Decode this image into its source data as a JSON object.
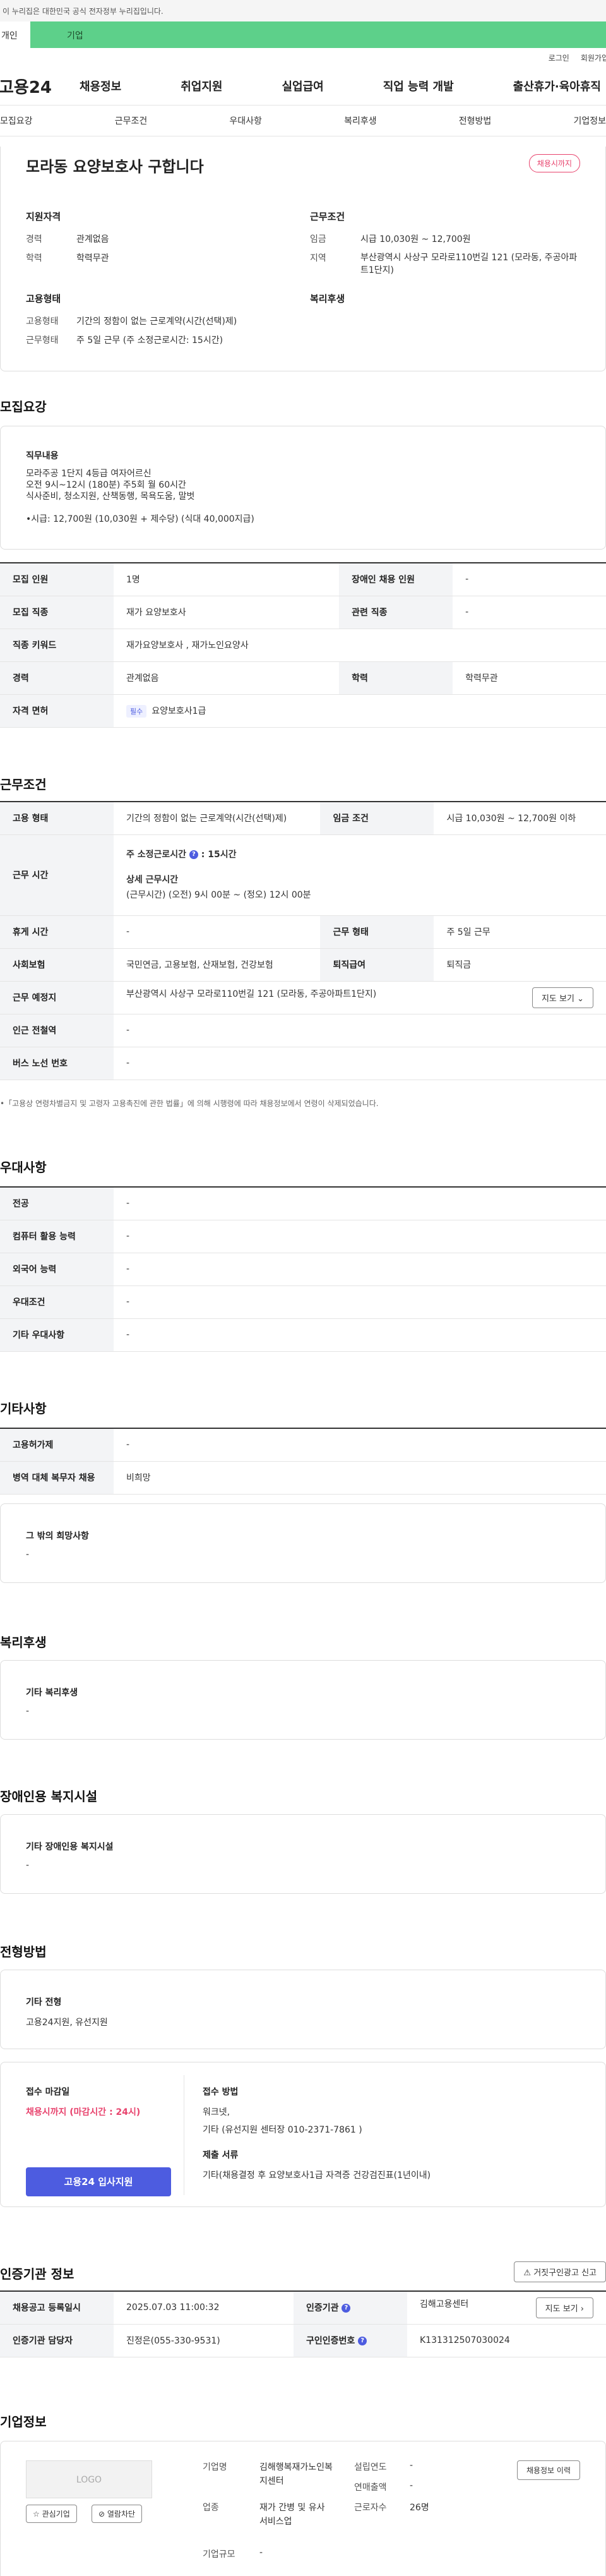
{
  "gov_banner": "이 누리집은 대한민국 공식 전자정부 누리집입니다.",
  "tabs": {
    "personal": "개인",
    "company": "기업"
  },
  "util": {
    "login": "로그인",
    "join": "회원가입"
  },
  "logo": "고용24",
  "gnb": [
    "채용정보",
    "취업지원",
    "실업급여",
    "직업 능력 개발",
    "출산휴가·육아휴직"
  ],
  "subnav": [
    "모집요강",
    "근무조건",
    "우대사항",
    "복리후생",
    "전형방법",
    "기업정보"
  ],
  "summary": {
    "title": "모라동 요양보호사 구합니다",
    "badge": "채용시까지",
    "qual_head": "지원자격",
    "career_label": "경력",
    "career": "관계없음",
    "edu_label": "학력",
    "edu": "학력무관",
    "cond_head": "근무조건",
    "wage_label": "임금",
    "wage": "시급 10,030원 ~ 12,700원",
    "region_label": "지역",
    "region": "부산광역시 사상구 모라로110번길 121 (모라동, 주공아파트1단지)",
    "emp_head": "고용형태",
    "emptype_label": "고용형태",
    "emptype": "기간의 정함이 없는 근로계약(시간(선택)제)",
    "worktype_label": "근무형태",
    "worktype": "주 5일 근무 (주 소정근로시간: 15시간)",
    "welfare_head": "복리후생"
  },
  "recruit": {
    "title": "모집요강",
    "duty_head": "직무내용",
    "duty_lines": [
      "모라주공 1단지 4등급 여자어르신",
      "오전 9시~12시 (180분) 주5회 월 60시간",
      "식사준비, 청소지원, 산책동행, 목욕도움, 말벗",
      "",
      "•시급: 12,700원 (10,030원 + 제수당) (식대 40,000지급)"
    ],
    "rows": [
      {
        "k1": "모집 인원",
        "v1": "1명",
        "k2": "장애인 채용 인원",
        "v2": "-"
      },
      {
        "k1": "모집 직종",
        "v1": "재가 요양보호사",
        "k2": "관련 직종",
        "v2": "-"
      },
      {
        "k1": "직종 키워드",
        "v1": "재가요양보호사 , 재가노인요양사"
      },
      {
        "k1": "경력",
        "v1": "관계없음",
        "k2": "학력",
        "v2": "학력무관"
      },
      {
        "k1": "자격 면허",
        "chip": "필수",
        "v1": "요양보호사1급"
      }
    ]
  },
  "conditions": {
    "title": "근무조건",
    "emp_label": "고용 형태",
    "emp": "기간의 정함이 없는 근로계약(시간(선택)제)",
    "wage_label": "임금 조건",
    "wage": "시급 10,030원 ~ 12,700원 이하",
    "hours_label": "근무 시간",
    "hours_head": "주 소정근로시간",
    "hours_val": ": 15시간",
    "hours_detail_head": "상세 근무시간",
    "hours_detail": "(근무시간) (오전) 9시 00분 ~ (정오) 12시 00분",
    "rest_label": "휴게 시간",
    "rest": "-",
    "form_label": "근무 형태",
    "form": "주 5일 근무",
    "ins_label": "사회보험",
    "ins": "국민연금, 고용보험, 산재보험, 건강보험",
    "ret_label": "퇴직급여",
    "ret": "퇴직금",
    "place_label": "근무 예정지",
    "place": "부산광역시 사상구 모라로110번길 121 (모라동, 주공아파트1단지)",
    "map_btn": "지도 보기",
    "subway_label": "인근 전철역",
    "subway": "-",
    "bus_label": "버스 노선 번호",
    "bus": "-",
    "note": "•「고용상 연령차별금지 및 고령자 고용촉진에 관한 법률」에 의해 시행령에 따라 채용정보에서 연령이 삭제되었습니다."
  },
  "prefer": {
    "title": "우대사항",
    "rows": [
      {
        "k": "전공",
        "v": "-"
      },
      {
        "k": "컴퓨터 활용 능력",
        "v": "-"
      },
      {
        "k": "외국어 능력",
        "v": "-"
      },
      {
        "k": "우대조건",
        "v": "-"
      },
      {
        "k": "기타 우대사항",
        "v": "-"
      }
    ]
  },
  "etc": {
    "title": "기타사항",
    "rows": [
      {
        "k": "고용허가제",
        "v": "-"
      },
      {
        "k": "병역 대체 복무자 채용",
        "v": "비희망"
      }
    ],
    "other_head": "그 밖의 희망사항",
    "other": "-"
  },
  "welfare": {
    "title": "복리후생",
    "head": "기타 복리후생",
    "val": "-"
  },
  "disabled": {
    "title": "장애인용 복지시설",
    "head": "기타 장애인용 복지시설",
    "val": "-"
  },
  "selection": {
    "title": "전형방법",
    "head": "기타 전형",
    "val": "고용24지원, 유선지원",
    "deadline_head": "접수 마감일",
    "deadline": "채용시까지 (마감시간 : 24시)",
    "method_head": "접수 방법",
    "method1": "워크넷,",
    "method2": "기타 (유선지원 센터장 010-2371-7861 )",
    "docs_head": "제출 서류",
    "docs": "기타(채용결정 후 요양보호사1급 자격증 건강검진표(1년이내)",
    "apply_btn": "고용24 입사지원"
  },
  "agency": {
    "title": "인증기관 정보",
    "report_btn": "거짓구인광고 신고",
    "reg_label": "채용공고 등록일시",
    "reg": "2025.07.03 11:00:32",
    "agency_label": "인증기관",
    "agency": "김해고용센터",
    "map_btn": "지도 보기",
    "mgr_label": "인증기관 담당자",
    "mgr": "진정은(055-330-9531)",
    "num_label": "구인인증번호",
    "num": "K131312507030024"
  },
  "company": {
    "title": "기업정보",
    "logo_text": "LOGO",
    "fav_btn": "관심기업",
    "block_btn": "열람차단",
    "name_label": "기업명",
    "name": "김해행복재가노인복지센터",
    "industry_label": "업종",
    "industry": "재가 간병 및 유사 서비스업",
    "size_label": "기업규모",
    "size": "-",
    "est_label": "설립연도",
    "est": "-",
    "sales_label": "연매출액",
    "sales": "-",
    "emp_label": "근로자수",
    "emp": "26명",
    "history_btn": "채용정보 이력"
  }
}
